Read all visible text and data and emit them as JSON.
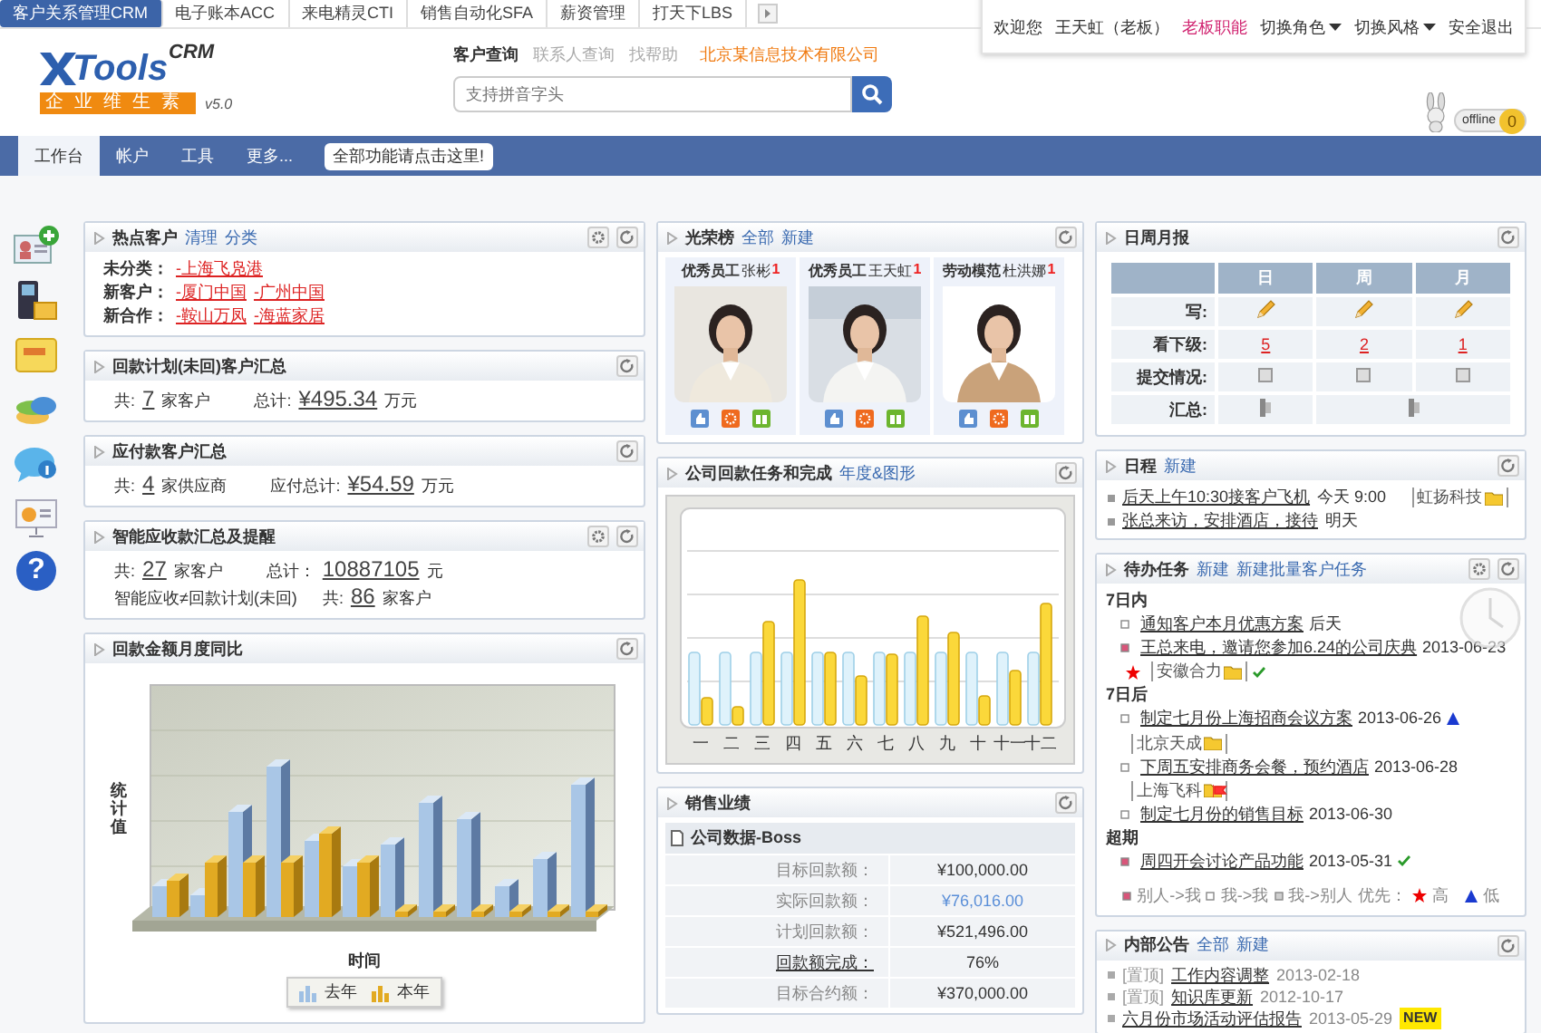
{
  "top_tabs": [
    {
      "label": "客户关系管理CRM",
      "selected": true
    },
    {
      "label": "电子账本ACC",
      "selected": false
    },
    {
      "label": "来电精灵CTI",
      "selected": false
    },
    {
      "label": "销售自动化SFA",
      "selected": false
    },
    {
      "label": "薪资管理",
      "selected": false
    },
    {
      "label": "打天下LBS",
      "selected": false
    }
  ],
  "user_bar": {
    "greeting": "欢迎您",
    "user": "王天虹（老板）",
    "role": "老板职能",
    "menus": [
      "切换角色",
      "切换风格"
    ],
    "logout": "安全退出"
  },
  "logo": {
    "name": "Tools",
    "product": "CRM",
    "slogan": "企业维生素",
    "version": "v5.0"
  },
  "search": {
    "tabs": [
      {
        "label": "客户查询",
        "selected": true
      },
      {
        "label": "联系人查询",
        "selected": false
      },
      {
        "label": "找帮助",
        "selected": false
      }
    ],
    "company": "北京某信息技术有限公司",
    "placeholder": "支持拼音字头"
  },
  "presence": {
    "status": "offline",
    "count": "0"
  },
  "nav": {
    "items": [
      {
        "label": "工作台",
        "selected": true
      },
      {
        "label": "帐户",
        "selected": false
      },
      {
        "label": "工具",
        "selected": false
      },
      {
        "label": "更多...",
        "selected": false
      }
    ],
    "tip": "全部功能请点击这里!"
  },
  "side_tools": {
    "help": "?"
  },
  "hot_customers": {
    "title": "热点客户",
    "links": [
      "清理",
      "分类"
    ],
    "settings": true,
    "rows": [
      {
        "label": "未分类：",
        "items": [
          "-上海飞凫港"
        ]
      },
      {
        "label": "新客户：",
        "items": [
          "-厦门中国",
          "-广州中国"
        ]
      },
      {
        "label": "新合作：",
        "items": [
          "-鞍山万凤",
          "-海蓝家居"
        ]
      }
    ]
  },
  "summaries": [
    {
      "title": "回款计划(未回)客户汇总",
      "settings": false,
      "lines": [
        [
          {
            "text": "共:",
            "kind": "text"
          },
          {
            "text": "7",
            "kind": "value"
          },
          {
            "text": "家客户",
            "kind": "text"
          },
          {
            "text": "总计:",
            "kind": "text"
          },
          {
            "text": "¥495.34",
            "kind": "value"
          },
          {
            "text": "万元",
            "kind": "text"
          }
        ]
      ]
    },
    {
      "title": "应付款客户汇总",
      "settings": false,
      "lines": [
        [
          {
            "text": "共:",
            "kind": "text"
          },
          {
            "text": "4",
            "kind": "value"
          },
          {
            "text": "家供应商",
            "kind": "text"
          },
          {
            "text": "应付总计:",
            "kind": "text"
          },
          {
            "text": "¥54.59",
            "kind": "value"
          },
          {
            "text": "万元",
            "kind": "text"
          }
        ]
      ]
    },
    {
      "title": "智能应收款汇总及提醒",
      "settings": true,
      "lines": [
        [
          {
            "text": "共:",
            "kind": "text"
          },
          {
            "text": "27",
            "kind": "value"
          },
          {
            "text": "家客户",
            "kind": "text"
          },
          {
            "text": "总计：",
            "kind": "text"
          },
          {
            "text": "10887105",
            "kind": "value"
          },
          {
            "text": "元",
            "kind": "text"
          }
        ],
        [
          {
            "text": "智能应收≠回款计划(未回)",
            "kind": "text"
          },
          {
            "text": "共:",
            "kind": "text"
          },
          {
            "text": "86",
            "kind": "value"
          },
          {
            "text": "家客户",
            "kind": "text"
          }
        ]
      ]
    }
  ],
  "monthly_compare": {
    "title": "回款金额月度同比",
    "ylabel": "统计值",
    "xlabel": "时间",
    "legend": [
      {
        "label": "去年",
        "color": "#9fc0e4"
      },
      {
        "label": "本年",
        "color": "#e2aa22"
      }
    ]
  },
  "honor": {
    "title": "光荣榜",
    "links": [
      "全部",
      "新建"
    ],
    "people": [
      {
        "title": "优秀员工",
        "name": "张彬",
        "count": "1"
      },
      {
        "title": "优秀员工",
        "name": "王天虹",
        "count": "1"
      },
      {
        "title": "劳动模范",
        "name": "杜洪娜",
        "count": "1"
      }
    ]
  },
  "task_chart": {
    "title": "公司回款任务和完成",
    "links": [
      "年度&图形"
    ],
    "categories": [
      "一",
      "二",
      "三",
      "四",
      "五",
      "六",
      "七",
      "八",
      "九",
      "十",
      "十一",
      "十二"
    ]
  },
  "sales": {
    "title": "销售业绩",
    "group": "公司数据-Boss",
    "rows": [
      {
        "label": "目标回款额：",
        "value": "¥100,000.00",
        "label_link": false,
        "value_link": false
      },
      {
        "label": "实际回款额：",
        "value": "¥76,016.00",
        "label_link": false,
        "value_link": true
      },
      {
        "label": "计划回款额：",
        "value": "¥521,496.00",
        "label_link": false,
        "value_link": false
      },
      {
        "label": "回款额完成：",
        "value": "76%",
        "label_link": true,
        "value_link": false
      },
      {
        "label": "目标合约额：",
        "value": "¥370,000.00",
        "label_link": false,
        "value_link": false
      }
    ]
  },
  "reports": {
    "title": "日周月报",
    "columns": [
      "日",
      "周",
      "月"
    ],
    "rows": [
      {
        "label": "写:",
        "kind": "write"
      },
      {
        "label": "看下级:",
        "kind": "count",
        "values": [
          "5",
          "2",
          "1"
        ]
      },
      {
        "label": "提交情况:",
        "kind": "status"
      },
      {
        "label": "汇总:",
        "kind": "summary"
      }
    ]
  },
  "schedule": {
    "title": "日程",
    "links": [
      "新建"
    ],
    "items": [
      {
        "text": "后天上午10:30接客户飞机",
        "time": "今天 9:00",
        "tag": "虹扬科技"
      },
      {
        "text": "张总来访，安排酒店，接待",
        "time": "明天"
      }
    ]
  },
  "todo": {
    "title": "待办任务",
    "links": [
      "新建",
      "新建批量客户任务"
    ],
    "settings": true,
    "groups": [
      {
        "title": "7日内",
        "items": [
          {
            "text": "通知客户本月优惠方案",
            "date": "后天",
            "kind": "self",
            "high": false,
            "low": false,
            "flag": false,
            "done": false
          },
          {
            "text": "王总来电，邀请您参加6.24的公司庆典",
            "date": "2013-06-23",
            "kind": "others",
            "high": true,
            "low": false,
            "tag": "安徽合力",
            "flag": false,
            "done": true
          }
        ]
      },
      {
        "title": "7日后",
        "items": [
          {
            "text": "制定七月份上海招商会议方案",
            "date": "2013-06-26",
            "kind": "self",
            "high": false,
            "low": true,
            "tag": "北京天成",
            "flag": false,
            "done": false
          },
          {
            "text": "下周五安排商务会餐，预约酒店",
            "date": "2013-06-28",
            "kind": "self",
            "high": false,
            "low": false,
            "tag": "上海飞科",
            "flag": true,
            "done": false
          },
          {
            "text": "制定七月份的销售目标",
            "date": "2013-06-30",
            "kind": "self",
            "high": false,
            "low": false,
            "flag": false,
            "done": false
          }
        ]
      },
      {
        "title": "超期",
        "items": [
          {
            "text": "周四开会讨论产品功能",
            "date": "2013-05-31",
            "kind": "others",
            "high": false,
            "low": false,
            "flag": false,
            "done": true
          }
        ]
      }
    ],
    "legend": {
      "sources": [
        {
          "label": "别人->我",
          "kind": "others"
        },
        {
          "label": "我->我",
          "kind": "self"
        },
        {
          "label": "我->别人",
          "kind": "out"
        }
      ],
      "priority_label": "优先：",
      "high": "高",
      "low": "低"
    }
  },
  "notices": {
    "title": "内部公告",
    "links": [
      "全部",
      "新建"
    ],
    "items": [
      {
        "pin": "[置顶]",
        "title": "工作内容调整",
        "date": "2013-02-18"
      },
      {
        "pin": "[置顶]",
        "title": "知识库更新",
        "date": "2012-10-17"
      },
      {
        "title": "六月份市场活动评估报告",
        "date": "2013-05-29",
        "badge": "NEW"
      }
    ]
  }
}
